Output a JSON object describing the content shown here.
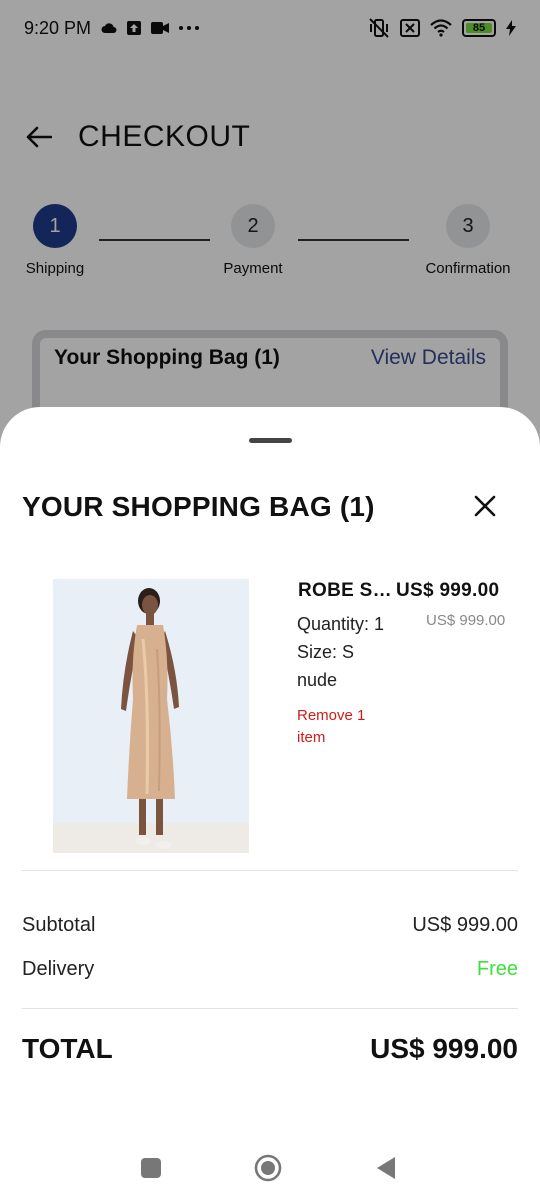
{
  "status_bar": {
    "time": "9:20 PM",
    "icons_left": [
      "cloud-icon",
      "upload-icon",
      "video-icon",
      "more-dots-icon"
    ],
    "icons_right": [
      "vibrate-off-icon",
      "no-sim-icon",
      "wifi-icon",
      "battery-icon",
      "charging-icon"
    ],
    "battery_level": "85"
  },
  "header": {
    "title": "CHECKOUT"
  },
  "stepper": {
    "steps": [
      {
        "number": "1",
        "label": "Shipping",
        "active": true
      },
      {
        "number": "2",
        "label": "Payment",
        "active": false
      },
      {
        "number": "3",
        "label": "Confirmation",
        "active": false
      }
    ]
  },
  "bag_card": {
    "title": "Your Shopping Bag (1)",
    "link": "View Details"
  },
  "sheet": {
    "title": "YOUR SHOPPING BAG (1)",
    "item": {
      "name": "ROBE SEQUIN",
      "price": "US$ 999.00",
      "quantity": "Quantity: 1",
      "original_price": "US$ 999.00",
      "size": "Size: S",
      "color": "nude",
      "remove_label": "Remove 1 item"
    },
    "summary": {
      "subtotal_label": "Subtotal",
      "subtotal_value": "US$ 999.00",
      "delivery_label": "Delivery",
      "delivery_value": "Free",
      "total_label": "TOTAL",
      "total_value": "US$ 999.00"
    }
  },
  "colors": {
    "accent": "#1f3b8c",
    "link": "#3c4a8c",
    "remove": "#d11a1a",
    "free": "#3ee03a"
  }
}
